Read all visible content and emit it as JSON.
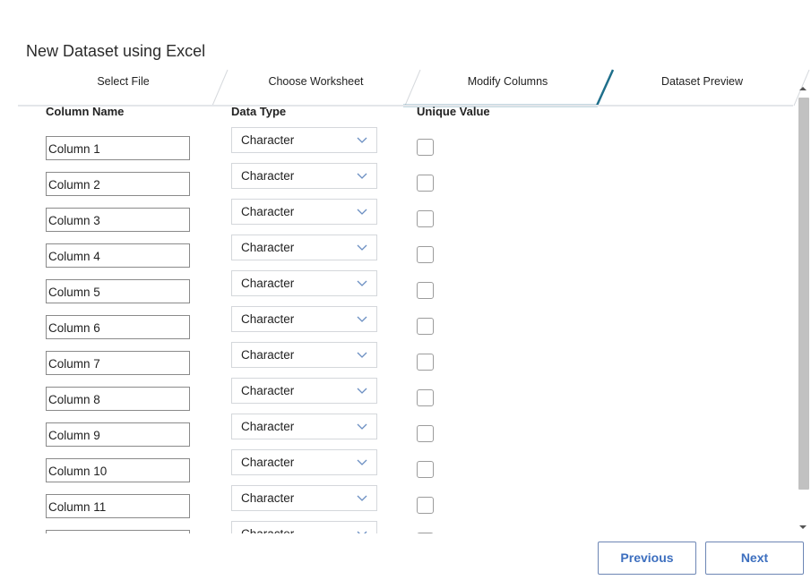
{
  "dialog": {
    "title": "New Dataset using Excel"
  },
  "wizard": {
    "steps": [
      {
        "label": "Select File"
      },
      {
        "label": "Choose Worksheet"
      },
      {
        "label": "Modify Columns"
      },
      {
        "label": "Dataset Preview"
      }
    ],
    "active_step": "Modify Columns",
    "accent_color": "#1f6f8b"
  },
  "headers": {
    "column_name": "Column Name",
    "data_type": "Data Type",
    "unique_value": "Unique Value"
  },
  "rows": [
    {
      "name": "Column 1",
      "type": "Character",
      "unique": false
    },
    {
      "name": "Column 2",
      "type": "Character",
      "unique": false
    },
    {
      "name": "Column 3",
      "type": "Character",
      "unique": false
    },
    {
      "name": "Column 4",
      "type": "Character",
      "unique": false
    },
    {
      "name": "Column 5",
      "type": "Character",
      "unique": false
    },
    {
      "name": "Column 6",
      "type": "Character",
      "unique": false
    },
    {
      "name": "Column 7",
      "type": "Character",
      "unique": false
    },
    {
      "name": "Column 8",
      "type": "Character",
      "unique": false
    },
    {
      "name": "Column 9",
      "type": "Character",
      "unique": false
    },
    {
      "name": "Column 10",
      "type": "Character",
      "unique": false
    },
    {
      "name": "Column 11",
      "type": "Character",
      "unique": false
    },
    {
      "name": "",
      "type": "Character",
      "unique": false
    }
  ],
  "footer": {
    "previous_label": "Previous",
    "next_label": "Next",
    "button_color": "#3d6fbf"
  }
}
